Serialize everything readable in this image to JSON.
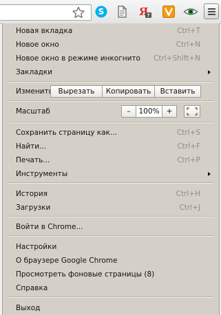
{
  "icons": {
    "star": "star-outline",
    "skype": "skype",
    "doc": "document",
    "yandex": "yandex",
    "v_ext": "v-extension",
    "eye": "eye",
    "menu": "hamburger"
  },
  "colors": {
    "skype": "#00aff0",
    "yandex": "#e62525",
    "v_ext": "#f39c12",
    "menu_bg": "#d4d0c8"
  },
  "menu": {
    "new_tab": {
      "label": "Новая вкладка",
      "shortcut": "Ctrl+T"
    },
    "new_window": {
      "label": "Новое окно",
      "shortcut": "Ctrl+N"
    },
    "incognito": {
      "label": "Новое окно в режиме инкогнито",
      "shortcut": "Ctrl+Shift+N"
    },
    "bookmarks": {
      "label": "Закладки"
    },
    "edit": {
      "label": "Изменить",
      "cut": "Вырезать",
      "copy": "Копировать",
      "paste": "Вставить"
    },
    "zoom": {
      "label": "Масштаб",
      "minus": "–",
      "value": "100%",
      "plus": "+"
    },
    "save_page": {
      "label": "Сохранить страницу как...",
      "shortcut": "Ctrl+S"
    },
    "find": {
      "label": "Найти...",
      "shortcut": "Ctrl+F"
    },
    "print": {
      "label": "Печать...",
      "shortcut": "Ctrl+P"
    },
    "tools": {
      "label": "Инструменты"
    },
    "history": {
      "label": "История",
      "shortcut": "Ctrl+H"
    },
    "downloads": {
      "label": "Загрузки",
      "shortcut": "Ctrl+J"
    },
    "signin": {
      "label": "Войти в Chrome..."
    },
    "settings": {
      "label": "Настройки"
    },
    "about": {
      "label": "О браузере Google Chrome"
    },
    "background_pages": {
      "label": "Просмотреть фоновые страницы (8)"
    },
    "help": {
      "label": "Справка"
    },
    "exit": {
      "label": "Выход"
    }
  }
}
